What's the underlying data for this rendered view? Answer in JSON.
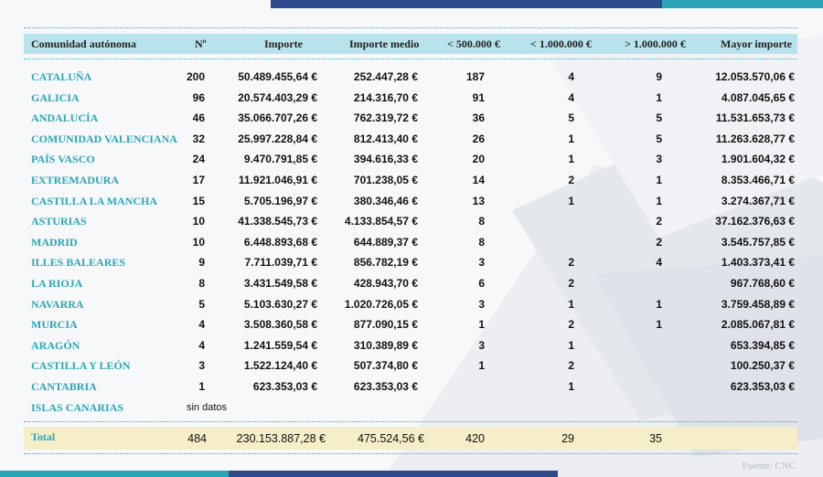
{
  "headers": {
    "region": "Comunidad autónoma",
    "n": "Nº",
    "importe": "Importe",
    "medio": "Importe medio",
    "lt500": "< 500.000 €",
    "lt1m": "< 1.000.000 €",
    "gt1m": "> 1.000.000 €",
    "mayor": "Mayor importe"
  },
  "rows": [
    {
      "region": "CATALUÑA",
      "n": "200",
      "importe": "50.489.455,64 €",
      "medio": "252.447,28 €",
      "lt500": "187",
      "lt1m": "4",
      "gt1m": "9",
      "mayor": "12.053.570,06 €"
    },
    {
      "region": "GALICIA",
      "n": "96",
      "importe": "20.574.403,29 €",
      "medio": "214.316,70 €",
      "lt500": "91",
      "lt1m": "4",
      "gt1m": "1",
      "mayor": "4.087.045,65 €"
    },
    {
      "region": "ANDALUCÍA",
      "n": "46",
      "importe": "35.066.707,26 €",
      "medio": "762.319,72 €",
      "lt500": "36",
      "lt1m": "5",
      "gt1m": "5",
      "mayor": "11.531.653,73 €"
    },
    {
      "region": "COMUNIDAD VALENCIANA",
      "n": "32",
      "importe": "25.997.228,84 €",
      "medio": "812.413,40 €",
      "lt500": "26",
      "lt1m": "1",
      "gt1m": "5",
      "mayor": "11.263.628,77 €"
    },
    {
      "region": "PAÍS VASCO",
      "n": "24",
      "importe": "9.470.791,85 €",
      "medio": "394.616,33 €",
      "lt500": "20",
      "lt1m": "1",
      "gt1m": "3",
      "mayor": "1.901.604,32 €"
    },
    {
      "region": "EXTREMADURA",
      "n": "17",
      "importe": "11.921.046,91 €",
      "medio": "701.238,05 €",
      "lt500": "14",
      "lt1m": "2",
      "gt1m": "1",
      "mayor": "8.353.466,71 €"
    },
    {
      "region": "CASTILLA LA MANCHA",
      "n": "15",
      "importe": "5.705.196,97 €",
      "medio": "380.346,46 €",
      "lt500": "13",
      "lt1m": "1",
      "gt1m": "1",
      "mayor": "3.274.367,71 €"
    },
    {
      "region": "ASTURIAS",
      "n": "10",
      "importe": "41.338.545,73 €",
      "medio": "4.133.854,57 €",
      "lt500": "8",
      "lt1m": "",
      "gt1m": "2",
      "mayor": "37.162.376,63 €"
    },
    {
      "region": "MADRID",
      "n": "10",
      "importe": "6.448.893,68 €",
      "medio": "644.889,37 €",
      "lt500": "8",
      "lt1m": "",
      "gt1m": "2",
      "mayor": "3.545.757,85 €"
    },
    {
      "region": "ILLES BALEARES",
      "n": "9",
      "importe": "7.711.039,71 €",
      "medio": "856.782,19 €",
      "lt500": "3",
      "lt1m": "2",
      "gt1m": "4",
      "mayor": "1.403.373,41 €"
    },
    {
      "region": "LA RIOJA",
      "n": "8",
      "importe": "3.431.549,58 €",
      "medio": "428.943,70 €",
      "lt500": "6",
      "lt1m": "2",
      "gt1m": "",
      "mayor": "967.768,60 €"
    },
    {
      "region": "NAVARRA",
      "n": "5",
      "importe": "5.103.630,27 €",
      "medio": "1.020.726,05 €",
      "lt500": "3",
      "lt1m": "1",
      "gt1m": "1",
      "mayor": "3.759.458,89 €"
    },
    {
      "region": "MURCIA",
      "n": "4",
      "importe": "3.508.360,58 €",
      "medio": "877.090,15 €",
      "lt500": "1",
      "lt1m": "2",
      "gt1m": "1",
      "mayor": "2.085.067,81 €"
    },
    {
      "region": "ARAGÓN",
      "n": "4",
      "importe": "1.241.559,54 €",
      "medio": "310.389,89 €",
      "lt500": "3",
      "lt1m": "1",
      "gt1m": "",
      "mayor": "653.394,85 €"
    },
    {
      "region": "CASTILLA Y LEÓN",
      "n": "3",
      "importe": "1.522.124,40 €",
      "medio": "507.374,80 €",
      "lt500": "1",
      "lt1m": "2",
      "gt1m": "",
      "mayor": "100.250,37 €"
    },
    {
      "region": "CANTABRIA",
      "n": "1",
      "importe": "623.353,03 €",
      "medio": "623.353,03 €",
      "lt500": "",
      "lt1m": "1",
      "gt1m": "",
      "mayor": "623.353,03 €"
    },
    {
      "region": "ISLAS CANARIAS",
      "n": "sin datos",
      "importe": "",
      "medio": "",
      "lt500": "",
      "lt1m": "",
      "gt1m": "",
      "mayor": ""
    }
  ],
  "total": {
    "label": "Total",
    "n": "484",
    "importe": "230.153.887,28 €",
    "medio": "475.524,56 €",
    "lt500": "420",
    "lt1m": "29",
    "gt1m": "35"
  },
  "source": "Fuente: CNC"
}
